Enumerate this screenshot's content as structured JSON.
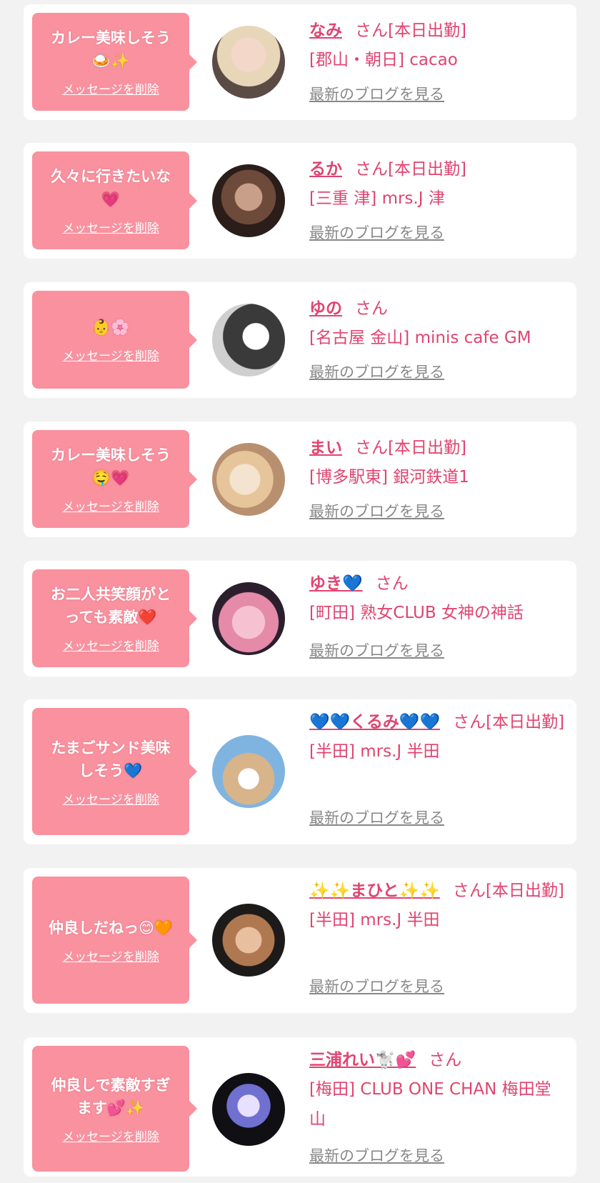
{
  "common": {
    "delete_label": "メッセージを削除",
    "blog_label": "最新のブログを見る",
    "san": "さん"
  },
  "cards": [
    {
      "message": "カレー美味しそう\n🍛✨",
      "name": "なみ",
      "status": "[本日出勤]",
      "shop": "[郡山・朝日] cacao",
      "avatar_colors": [
        "#5b4b45",
        "#e8d6b8",
        "#f3d7c8"
      ]
    },
    {
      "message": "久々に行きたいな\n💗",
      "name": "るか",
      "status": "[本日出勤]",
      "shop": "[三重 津] mrs.J 津",
      "avatar_colors": [
        "#2a1d1a",
        "#6e4a3a",
        "#c8a08a"
      ]
    },
    {
      "message": "👶🌸",
      "name": "ゆの",
      "status": "",
      "shop": "[名古屋 金山] minis cafe GM",
      "avatar_colors": [
        "#cfcfcf",
        "#3a3a3a",
        "#ffffff"
      ]
    },
    {
      "message": "カレー美味しそう\n🤤💗",
      "name": "まい",
      "status": "[本日出勤]",
      "shop": "[博多駅東] 銀河鉄道1",
      "avatar_colors": [
        "#b89070",
        "#e7c59a",
        "#f3e3cf"
      ]
    },
    {
      "message": "お二人共笑顔がと\nっても素敵❤️",
      "name": "ゆき💙",
      "status": "",
      "shop": "[町田] 熟女CLUB 女神の神話",
      "avatar_colors": [
        "#2b1f2e",
        "#e58aa8",
        "#f6c2d2"
      ]
    },
    {
      "message": "たまごサンド美味\nしそう💙",
      "name": "💙💙くるみ💙💙",
      "status": "[本日出勤]",
      "shop": "[半田] mrs.J 半田",
      "avatar_colors": [
        "#7fb4e0",
        "#d8b48a",
        "#ffffff"
      ]
    },
    {
      "message": "仲良しだねっ😊🧡",
      "name": "✨✨まひと✨✨",
      "status": "[本日出勤]",
      "shop": "[半田] mrs.J 半田",
      "avatar_colors": [
        "#1d1a1a",
        "#b07850",
        "#e8c0a0"
      ]
    },
    {
      "message": "仲良しで素敵すぎ\nます💕✨",
      "name": "三浦れい🐩💕",
      "status": "",
      "shop": "[梅田] CLUB ONE CHAN 梅田堂\n山",
      "avatar_colors": [
        "#0f0f14",
        "#7070d0",
        "#e8e0ff"
      ]
    }
  ]
}
